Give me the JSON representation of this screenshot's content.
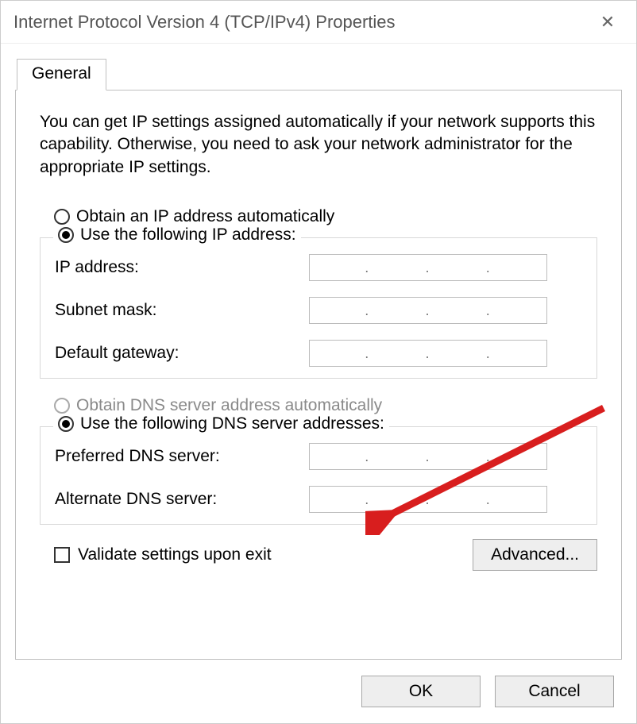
{
  "window": {
    "title": "Internet Protocol Version 4 (TCP/IPv4) Properties"
  },
  "tab": {
    "general": "General"
  },
  "intro": "You can get IP settings assigned automatically if your network supports this capability. Otherwise, you need to ask your network administrator for the appropriate IP settings.",
  "ip_section": {
    "auto_label": "Obtain an IP address automatically",
    "manual_label": "Use the following IP address:",
    "selected": "manual",
    "fields": {
      "ip_label": "IP address:",
      "subnet_label": "Subnet mask:",
      "gateway_label": "Default gateway:",
      "ip_value": "",
      "subnet_value": "",
      "gateway_value": ""
    }
  },
  "dns_section": {
    "auto_label": "Obtain DNS server address automatically",
    "auto_enabled": false,
    "manual_label": "Use the following DNS server addresses:",
    "selected": "manual",
    "fields": {
      "preferred_label": "Preferred DNS server:",
      "alternate_label": "Alternate DNS server:",
      "preferred_value": "",
      "alternate_value": ""
    }
  },
  "validate_label": "Validate settings upon exit",
  "validate_checked": false,
  "advanced_button": "Advanced...",
  "ok_button": "OK",
  "cancel_button": "Cancel"
}
